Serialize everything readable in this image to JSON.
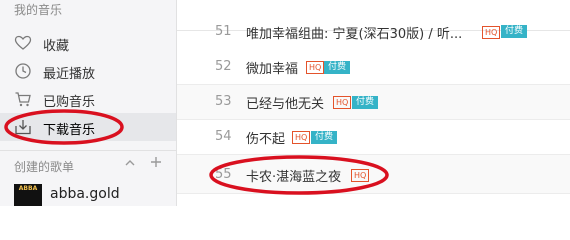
{
  "sidebar": {
    "section_title": "我的音乐",
    "items": [
      {
        "label": "收藏",
        "icon": "heart-icon"
      },
      {
        "label": "最近播放",
        "icon": "clock-icon"
      },
      {
        "label": "已购音乐",
        "icon": "cart-icon"
      },
      {
        "label": "下载音乐",
        "icon": "download-icon",
        "active": true
      }
    ],
    "playlists_title": "创建的歌单",
    "playlists": [
      {
        "name": "abba.gold",
        "cover_text": "ABBA"
      }
    ]
  },
  "songs": [
    {
      "num": "51",
      "title": "唯加幸福组曲: 宁夏(深石30版) / 听...",
      "hq": "HQ",
      "paid": "付费"
    },
    {
      "num": "52",
      "title": "微加幸福",
      "hq": "HQ",
      "paid": "付费"
    },
    {
      "num": "53",
      "title": "已经与他无关",
      "hq": "HQ",
      "paid": "付费"
    },
    {
      "num": "54",
      "title": "伤不起",
      "hq": "HQ",
      "paid": "付费"
    },
    {
      "num": "55",
      "title": "卡农·湛海蓝之夜",
      "hq": "HQ"
    }
  ],
  "colors": {
    "sidebar_bg": "#f5f5f7",
    "active_bg": "#e6e7ea",
    "hq_badge": "#e4532b",
    "paid_badge": "#35b3c7",
    "annotation_red": "#d9101f"
  }
}
